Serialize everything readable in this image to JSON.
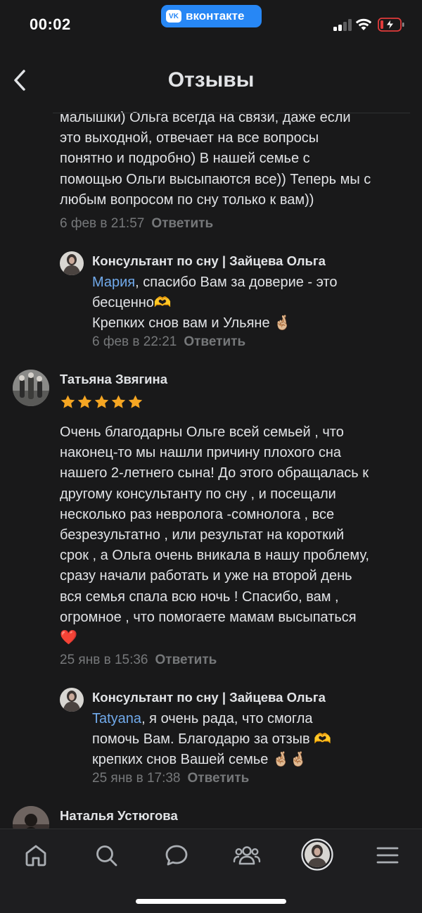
{
  "status_bar": {
    "time": "00:02",
    "app_badge": "вконтакте",
    "app_badge_logo": "VK"
  },
  "header": {
    "title": "Отзывы",
    "back_icon": "chevron-left-icon"
  },
  "reviews": [
    {
      "text_lines": [
        "малышки) Ольга всегда на связи, даже если",
        "это выходной, отвечает на все вопросы",
        "понятно и подробно) В нашей семье с",
        "помощью Ольги высыпаются все)) Теперь мы с",
        "любым вопросом по сну только к вам))"
      ],
      "date": "6 фев в 21:57",
      "reply_label": "Ответить",
      "reply": {
        "author": "Консультант по сну | Зайцева Ольга",
        "mention": "Мария",
        "line1_rest": ", спасибо Вам за доверие - это",
        "line2": "бесценно",
        "line2_emoji": "🫶",
        "line3": "Крепких снов вам и Ульяне ",
        "line3_emoji": "🤞🏼",
        "date": "6 фев в 22:21",
        "reply_label": "Ответить"
      }
    },
    {
      "author": "Татьяна Звягина",
      "rating": 5,
      "text_lines": [
        "Очень благодарны Ольге всей семьей , что",
        "наконец-то мы нашли причину плохого сна",
        "нашего 2-летнего сына! До этого обращалась к",
        "другому консультанту по сну , и посещали",
        "несколько раз невролога -сомнолога , все",
        "безрезультатно , или результат на короткий",
        "срок , а Ольга очень вникала в нашу проблему,",
        "сразу начали работать и уже на второй день",
        "вся семья спала всю ночь !  Спасибо, вам ,",
        "огромное , что помогаете мамам высыпаться"
      ],
      "emoji": "❤️",
      "date": "25 янв в 15:36",
      "reply_label": "Ответить",
      "reply": {
        "author": "Консультант по сну | Зайцева Ольга",
        "mention": "Tatyana",
        "line1_rest": ", я очень рада, что смогла",
        "line2": "помочь Вам. Благодарю за отзыв ",
        "line2_emoji": "🫶",
        "line3": "крепких снов Вашей семье ",
        "line3_emoji": "🤞🏼🤞🏼",
        "date": "25 янв в 17:38",
        "reply_label": "Ответить"
      }
    },
    {
      "author": "Наталья Устюгова"
    }
  ],
  "tabbar": {
    "items": [
      "home-icon",
      "search-icon",
      "messages-icon",
      "friends-icon",
      "profile-avatar",
      "menu-icon"
    ]
  },
  "colors": {
    "background": "#19191a",
    "text": "#e1e3e6",
    "muted": "#76787a",
    "link": "#71aaeb",
    "accent": "#2787f5",
    "star": "#f5a623"
  }
}
